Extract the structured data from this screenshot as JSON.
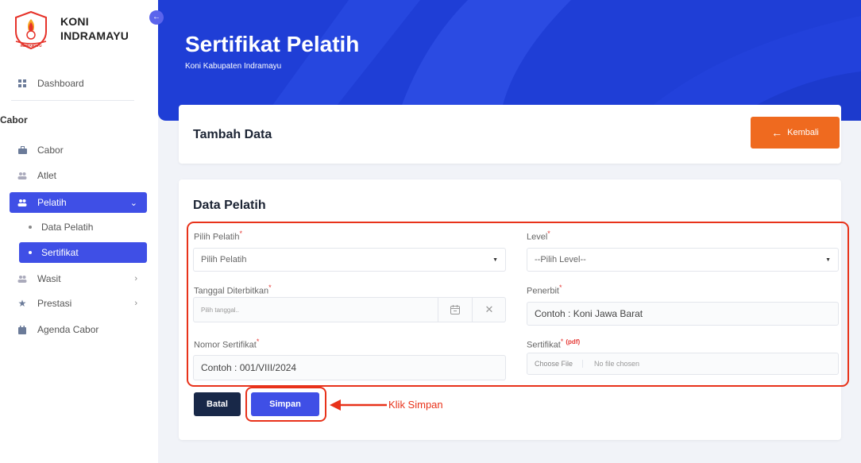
{
  "brand": {
    "line1": "KONI",
    "line2": "INDRAMAYU",
    "logo_text": "INDRAMAYU"
  },
  "sidebar": {
    "dashboard": "Dashboard",
    "section": "Cabor",
    "items": [
      {
        "label": "Cabor",
        "icon": "briefcase-icon"
      },
      {
        "label": "Atlet",
        "icon": "users-icon"
      },
      {
        "label": "Pelatih",
        "icon": "users-icon"
      },
      {
        "label": "Wasit",
        "icon": "users-icon"
      },
      {
        "label": "Prestasi",
        "icon": "star-icon"
      },
      {
        "label": "Agenda Cabor",
        "icon": "calendar-icon"
      }
    ],
    "sub_items": [
      "Data Pelatih",
      "Sertifikat"
    ]
  },
  "header": {
    "title": "Sertifikat Pelatih",
    "subtitle": "Koni Kabupaten Indramayu"
  },
  "card1": {
    "title": "Tambah Data",
    "back_label": "Kembali"
  },
  "form": {
    "title": "Data Pelatih",
    "pelatih": {
      "label": "Pilih Pelatih",
      "value": "Pilih Pelatih"
    },
    "level": {
      "label": "Level",
      "value": "--Pilih Level--"
    },
    "tanggal": {
      "label": "Tanggal Diterbitkan",
      "placeholder": "Pilih tanggal.."
    },
    "penerbit": {
      "label": "Penerbit",
      "placeholder": "Contoh : Koni Jawa Barat"
    },
    "nomor": {
      "label": "Nomor Sertifikat",
      "placeholder": "Contoh : 001/VIII/2024"
    },
    "sertifikat": {
      "label": "Sertifikat",
      "format": "(pdf)",
      "choose": "Choose File",
      "note": "No file chosen"
    },
    "required_mark": "*"
  },
  "buttons": {
    "batal": "Batal",
    "simpan": "Simpan"
  },
  "annotation": "Klik Simpan",
  "colors": {
    "primary": "#3f4fe6",
    "header": "#1f3ed6",
    "orange": "#ef6a1f",
    "annotation": "#e8321a",
    "dark": "#182848"
  }
}
